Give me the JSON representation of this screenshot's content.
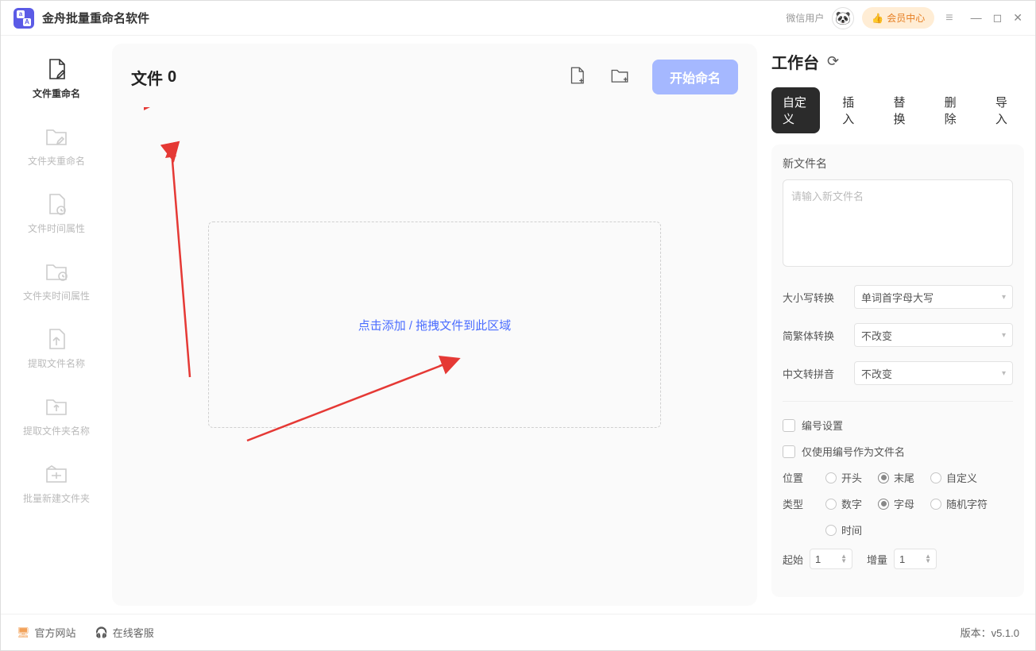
{
  "app": {
    "title": "金舟批量重命名软件"
  },
  "titlebar": {
    "wx_user": "微信用户",
    "vip": "会员中心"
  },
  "sidebar": {
    "items": [
      {
        "label": "文件重命名"
      },
      {
        "label": "文件夹重命名"
      },
      {
        "label": "文件时间属性"
      },
      {
        "label": "文件夹时间属性"
      },
      {
        "label": "提取文件名称"
      },
      {
        "label": "提取文件夹名称"
      },
      {
        "label": "批量新建文件夹"
      }
    ]
  },
  "content": {
    "file_label": "文件",
    "file_count": "0",
    "start_btn": "开始命名",
    "drop_text": "点击添加 / 拖拽文件到此区域"
  },
  "panel": {
    "title": "工作台",
    "tabs": [
      "自定义",
      "插入",
      "替换",
      "删除",
      "导入"
    ],
    "new_name_label": "新文件名",
    "new_name_placeholder": "请输入新文件名",
    "case_label": "大小写转换",
    "case_value": "单词首字母大写",
    "simp_label": "简繁体转换",
    "simp_value": "不改变",
    "pinyin_label": "中文转拼音",
    "pinyin_value": "不改变",
    "number_setting": "编号设置",
    "only_number": "仅使用编号作为文件名",
    "pos_label": "位置",
    "pos_opts": [
      "开头",
      "末尾",
      "自定义"
    ],
    "type_label": "类型",
    "type_opts": [
      "数字",
      "字母",
      "随机字符",
      "时间"
    ],
    "start_label": "起始",
    "start_value": "1",
    "step_label": "增量",
    "step_value": "1"
  },
  "footer": {
    "site": "官方网站",
    "service": "在线客服",
    "version": "版本：v5.1.0"
  }
}
